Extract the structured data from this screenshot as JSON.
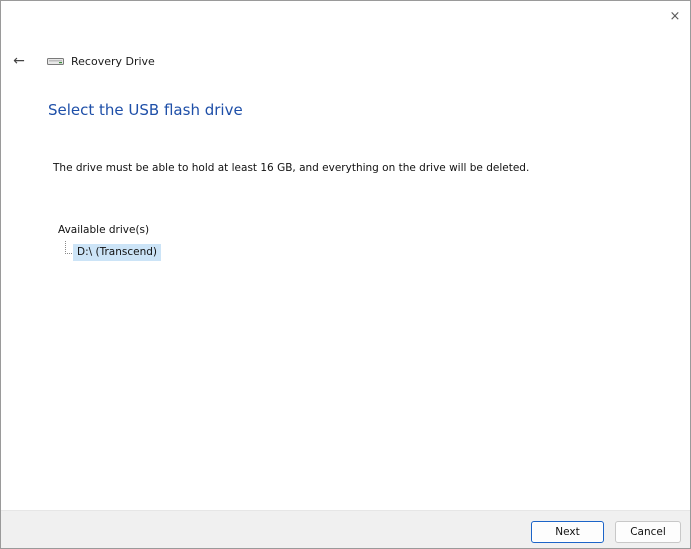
{
  "window": {
    "title": "Recovery Drive",
    "close_glyph": "×",
    "back_glyph": "←",
    "icons": {
      "close": "close-icon",
      "back": "back-arrow-icon",
      "drive": "drive-icon"
    }
  },
  "page": {
    "heading": "Select the USB flash drive",
    "description": "The drive must be able to hold at least 16 GB, and everything on the drive will be deleted."
  },
  "drives": {
    "label": "Available drive(s)",
    "items": [
      {
        "label": "D:\\ (Transcend)",
        "selected": true
      }
    ]
  },
  "buttons": {
    "next": "Next",
    "cancel": "Cancel"
  },
  "colors": {
    "heading": "#1e4fa8",
    "selection": "#cce4f7",
    "primary_border": "#1c64c8",
    "footer": "#f0f0f0"
  }
}
